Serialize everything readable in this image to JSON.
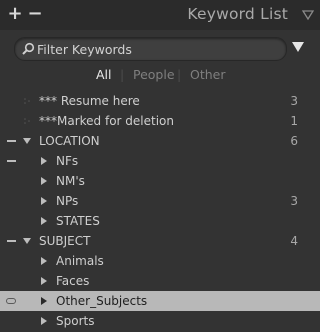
{
  "header": {
    "add_label": "+",
    "remove_label": "−",
    "title": "Keyword List"
  },
  "search": {
    "placeholder": "Filter Keywords"
  },
  "tabs": [
    {
      "label": "All",
      "active": true
    },
    {
      "label": "People",
      "active": false
    },
    {
      "label": "Other",
      "active": false
    }
  ],
  "rows": [
    {
      "label": "*** Resume here",
      "count": "3"
    },
    {
      "label": "***Marked for deletion",
      "count": "1"
    },
    {
      "label": "LOCATION",
      "count": "6"
    },
    {
      "label": "NFs",
      "count": ""
    },
    {
      "label": "NM's",
      "count": ""
    },
    {
      "label": "NPs",
      "count": "3"
    },
    {
      "label": "STATES",
      "count": ""
    },
    {
      "label": "SUBJECT",
      "count": "4"
    },
    {
      "label": "Animals",
      "count": ""
    },
    {
      "label": "Faces",
      "count": ""
    },
    {
      "label": "Other_Subjects",
      "count": ""
    },
    {
      "label": "Sports",
      "count": ""
    }
  ],
  "colors": {
    "panel_bg": "#333333",
    "header_bg": "#2b2b2b",
    "selected_row_bg": "#b8b8b8",
    "text": "#cfcfcf"
  }
}
